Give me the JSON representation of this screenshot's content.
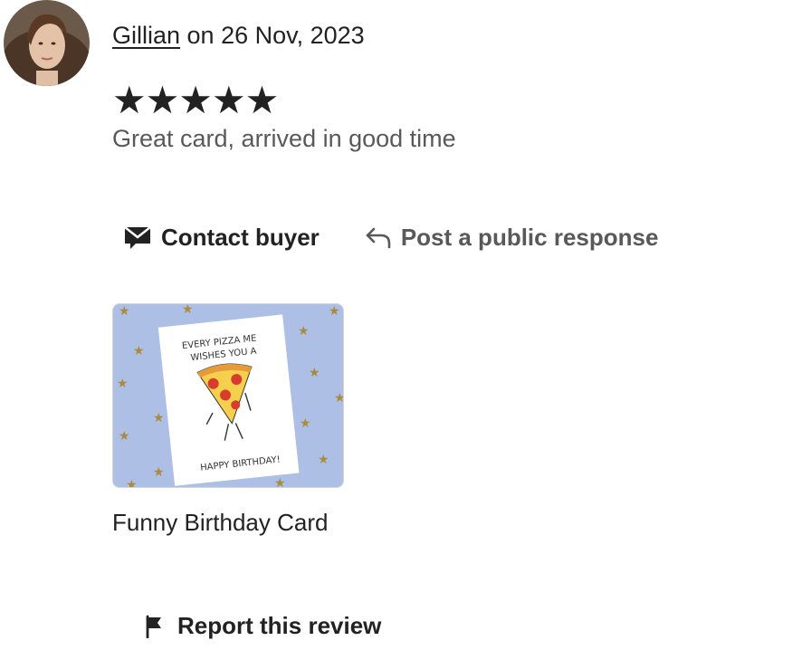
{
  "review": {
    "author": "Gillian",
    "date_text": " on 26 Nov, 2023",
    "rating": 5,
    "stars_text": "★★★★★",
    "text": "Great card, arrived in good time"
  },
  "actions": {
    "contact_label": "Contact buyer",
    "public_response_label": "Post a public response"
  },
  "product": {
    "title": "Funny Birthday Card",
    "card_text_line1": "EVERY PIZZA ME",
    "card_text_line2": "WISHES YOU A",
    "card_text_line3": "HAPPY BIRTHDAY!"
  },
  "report": {
    "label": "Report this review"
  },
  "colors": {
    "text": "#222222",
    "muted": "#595959",
    "thumb_bg": "#aebfe6",
    "star_gold": "#a88b3c"
  },
  "icons": [
    "avatar-photo",
    "mail-icon",
    "reply-arrow-icon",
    "flag-icon"
  ]
}
